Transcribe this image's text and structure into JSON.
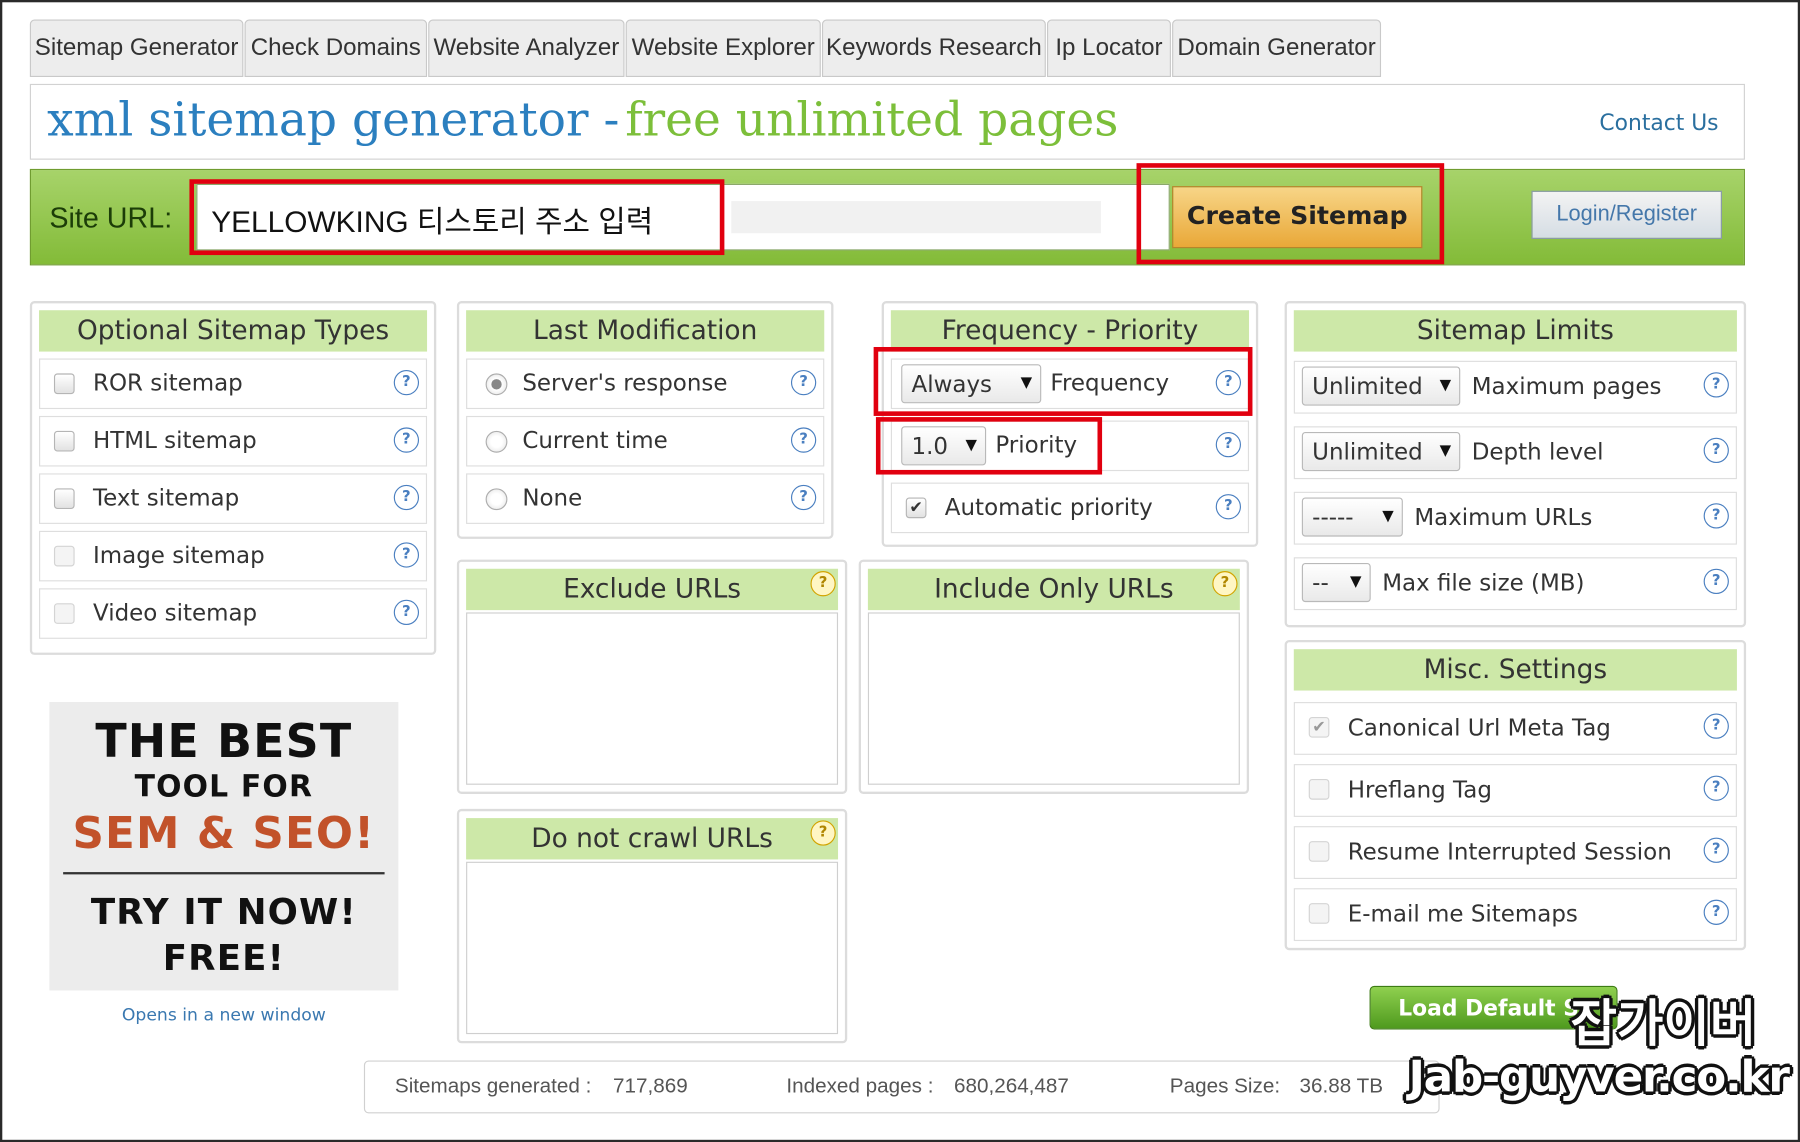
{
  "tabs": [
    "Sitemap Generator",
    "Check Domains",
    "Website Analyzer",
    "Website Explorer",
    "Keywords Research",
    "Ip Locator",
    "Domain Generator"
  ],
  "header": {
    "title_part1": "xml sitemap generator -",
    "title_part2": "free unlimited pages",
    "contact": "Contact Us"
  },
  "urlbar": {
    "label": "Site URL:",
    "input_value": "YELLOWKING 티스토리 주소 입력",
    "create_button": "Create Sitemap",
    "login_button": "Login/Register"
  },
  "optional_types": {
    "title": "Optional Sitemap Types",
    "items": [
      "ROR sitemap",
      "HTML sitemap",
      "Text sitemap",
      "Image sitemap",
      "Video sitemap"
    ]
  },
  "last_modification": {
    "title": "Last Modification",
    "options": [
      "Server's response",
      "Current time",
      "None"
    ],
    "selected": "Server's response"
  },
  "frequency_priority": {
    "title": "Frequency - Priority",
    "frequency_value": "Always",
    "frequency_label": "Frequency",
    "priority_value": "1.0",
    "priority_label": "Priority",
    "auto_priority_label": "Automatic priority",
    "auto_priority_checked": true
  },
  "sitemap_limits": {
    "title": "Sitemap Limits",
    "max_pages_value": "Unlimited",
    "max_pages_label": "Maximum pages",
    "depth_value": "Unlimited",
    "depth_label": "Depth level",
    "max_urls_value": "-----",
    "max_urls_label": "Maximum URLs",
    "max_file_value": "--",
    "max_file_label": "Max file size (MB)"
  },
  "exclude_urls": {
    "title": "Exclude URLs"
  },
  "include_urls": {
    "title": "Include Only URLs"
  },
  "do_not_crawl": {
    "title": "Do not crawl URLs"
  },
  "misc": {
    "title": "Misc. Settings",
    "items": [
      "Canonical Url Meta Tag",
      "Hreflang Tag",
      "Resume Interrupted Session",
      "E-mail me Sitemaps"
    ]
  },
  "ad": {
    "line1": "THE BEST",
    "line2": "TOOL FOR",
    "line3": "SEM & SEO!",
    "line4": "TRY IT NOW!",
    "line5": "FREE!",
    "caption": "Opens in a new window"
  },
  "load_button": "Load Default S",
  "stats": {
    "generated_label": "Sitemaps generated :",
    "generated_value": "717,869",
    "indexed_label": "Indexed pages :",
    "indexed_value": "680,264,487",
    "size_label": "Pages Size:",
    "size_value": "36.88 TB"
  },
  "watermark": {
    "korean": "잡가이버",
    "url": "Jab-guyver.co.kr"
  },
  "colors": {
    "accent_blue": "#2b7fbf",
    "accent_green": "#7cbf3a",
    "highlight_red": "#e1000f"
  }
}
